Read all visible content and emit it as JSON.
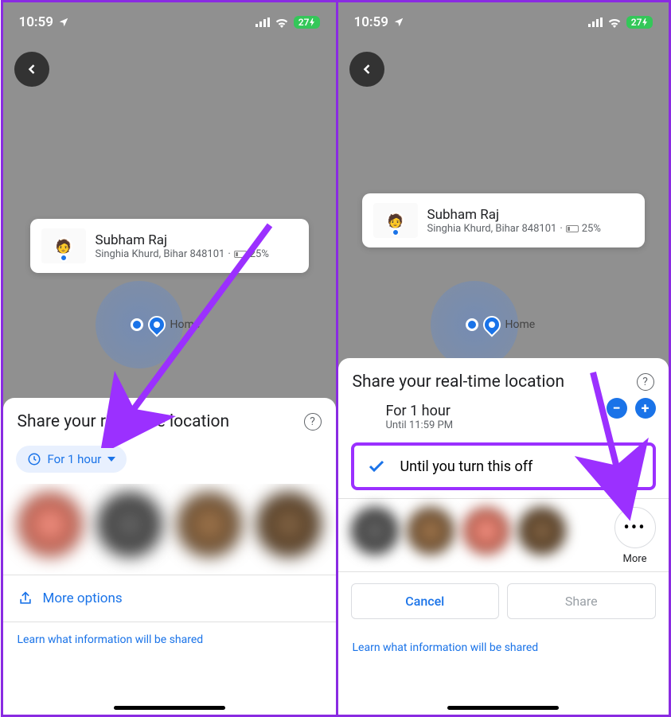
{
  "status_bar": {
    "time": "10:59",
    "battery_text": "27"
  },
  "contact": {
    "name": "Subham Raj",
    "location": "Singhia Khurd, Bihar 848101",
    "battery_percent": "25%"
  },
  "map": {
    "home_label": "Home"
  },
  "sheet": {
    "title": "Share your real-time location",
    "duration_pill": "For 1 hour",
    "more_options": "More options",
    "learn_link": "Learn what information will be shared"
  },
  "sheet2": {
    "title": "Share your real-time location",
    "option1_label": "For 1 hour",
    "option1_sub": "Until 11:59 PM",
    "option2_label": "Until you turn this off",
    "more_label": "More",
    "cancel": "Cancel",
    "share": "Share",
    "learn_link": "Learn what information will be shared"
  },
  "annotations": {
    "arrow_color": "#9b30ff",
    "highlight_color": "#9b30ff"
  }
}
